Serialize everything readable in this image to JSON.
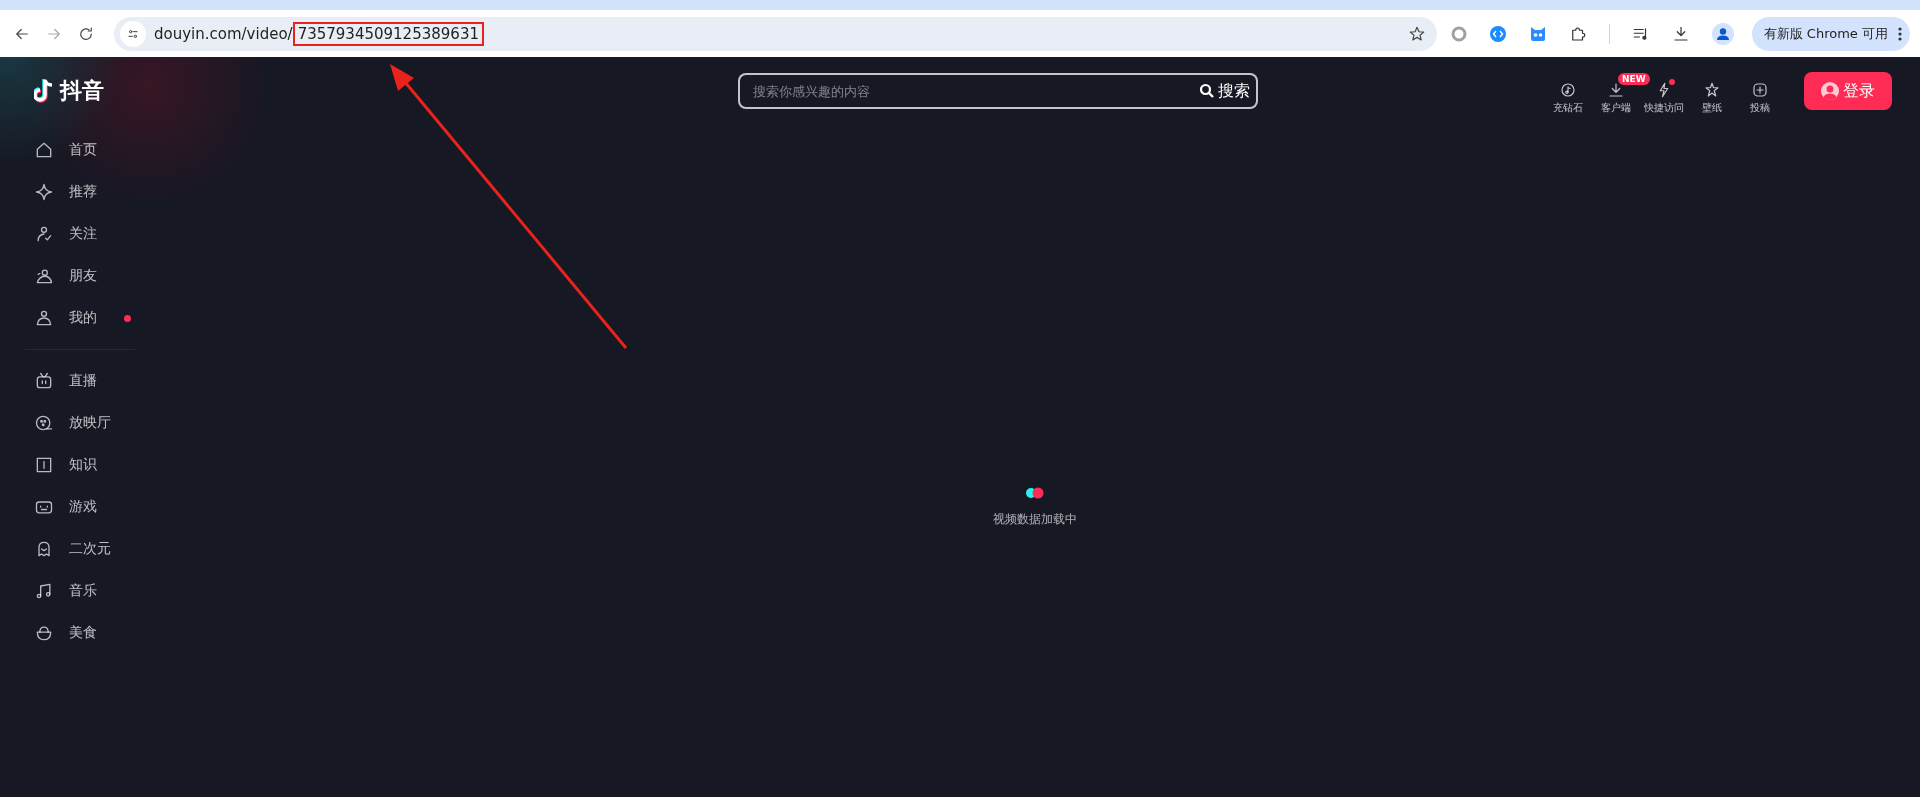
{
  "browser": {
    "url_host": "douyin.com/video/",
    "url_id": "7357934509125389631",
    "update_button": "有新版 Chrome 可用"
  },
  "header": {
    "logo": "抖音",
    "search": {
      "placeholder": "搜索你感兴趣的内容",
      "button": "搜索"
    },
    "actions": [
      {
        "label": "充钻石",
        "dot": false
      },
      {
        "label": "客户端",
        "badge": "NEW",
        "dot": false
      },
      {
        "label": "快捷访问",
        "dot": true
      },
      {
        "label": "壁纸",
        "dot": false
      },
      {
        "label": "投稿",
        "dot": false
      }
    ],
    "login": "登录"
  },
  "sidebar": {
    "groups": [
      [
        {
          "label": "首页",
          "dot": false
        },
        {
          "label": "推荐",
          "dot": false
        },
        {
          "label": "关注",
          "dot": false
        },
        {
          "label": "朋友",
          "dot": false
        },
        {
          "label": "我的",
          "dot": true
        }
      ],
      [
        {
          "label": "直播",
          "dot": false
        },
        {
          "label": "放映厅",
          "dot": false
        },
        {
          "label": "知识",
          "dot": false
        },
        {
          "label": "游戏",
          "dot": false
        },
        {
          "label": "二次元",
          "dot": false
        },
        {
          "label": "音乐",
          "dot": false
        },
        {
          "label": "美食",
          "dot": false
        }
      ]
    ]
  },
  "loading": {
    "text": "视频数据加载中"
  }
}
